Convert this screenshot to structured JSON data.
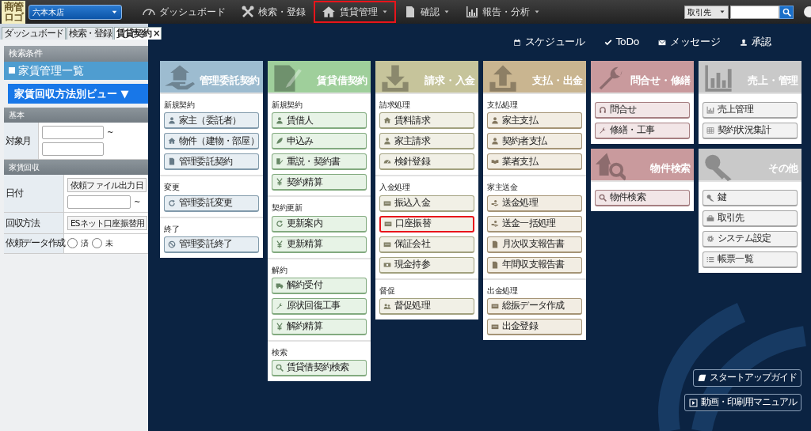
{
  "logo": {
    "text": "商管ロゴ"
  },
  "store_select": {
    "value": "六本木店"
  },
  "nav": [
    {
      "label": "ダッシュボード",
      "dropdown": false,
      "highlighted": false
    },
    {
      "label": "検索・登録",
      "dropdown": false,
      "highlighted": false
    },
    {
      "label": "賃貸管理",
      "dropdown": true,
      "highlighted": true
    },
    {
      "label": "確認",
      "dropdown": true,
      "highlighted": false
    },
    {
      "label": "報告・分析",
      "dropdown": true,
      "highlighted": false
    }
  ],
  "partner_select": {
    "value": "取引先"
  },
  "tabs": [
    {
      "label": "ダッシュボード",
      "selected": false
    },
    {
      "label": "検索・登録",
      "selected": false
    },
    {
      "label": "賃貸契約",
      "selected": true,
      "close": "×"
    }
  ],
  "search_panel": {
    "header": "検索条件",
    "title": "家賃管理一覧",
    "view_button": "家賃回収方法別ビュー ▼",
    "sections": [
      {
        "heading": "基本",
        "fields": [
          {
            "kind": "range",
            "label": "対象月",
            "separator": "~"
          }
        ]
      },
      {
        "heading": "家賃回収",
        "fields": [
          {
            "kind": "select_range",
            "label": "日付",
            "value": "依頼ファイル出力日",
            "separator": "~"
          },
          {
            "kind": "select",
            "label": "回収方法",
            "value": "ESネット口座振替用"
          },
          {
            "kind": "radio",
            "label": "依頼データ作成",
            "options": [
              {
                "label": "済",
                "selected": false
              },
              {
                "label": "未",
                "selected": false
              }
            ]
          }
        ]
      }
    ]
  },
  "top_links": [
    {
      "label": "スケジュール"
    },
    {
      "label": "ToDo"
    },
    {
      "label": "メッセージ"
    },
    {
      "label": "承認"
    }
  ],
  "columns": [
    {
      "tiles": [
        {
          "title": "管理委託契約",
          "color": "#9dbcd0",
          "sections": [
            {
              "heading": "新規契約",
              "buttons": [
                {
                  "label": "家主（委託者）",
                  "highlighted": false
                },
                {
                  "label": "物件（建物・部屋）",
                  "highlighted": false
                },
                {
                  "label": "管理委託契約",
                  "highlighted": false
                }
              ]
            },
            {
              "heading": "変更",
              "buttons": [
                {
                  "label": "管理委託変更",
                  "highlighted": false
                }
              ]
            },
            {
              "heading": "終了",
              "buttons": [
                {
                  "label": "管理委託終了",
                  "highlighted": false
                }
              ]
            }
          ]
        }
      ]
    },
    {
      "tiles": [
        {
          "title": "賃貸借契約",
          "color": "#9fcf9b",
          "sections": [
            {
              "heading": "新規契約",
              "buttons": [
                {
                  "label": "賃借人",
                  "highlighted": false
                },
                {
                  "label": "申込み",
                  "highlighted": false
                },
                {
                  "label": "重説・契約書",
                  "highlighted": false
                },
                {
                  "label": "契約精算",
                  "highlighted": false
                }
              ]
            },
            {
              "heading": "契約更新",
              "buttons": [
                {
                  "label": "更新案内",
                  "highlighted": false
                },
                {
                  "label": "更新精算",
                  "highlighted": false
                }
              ]
            },
            {
              "heading": "解約",
              "buttons": [
                {
                  "label": "解約受付",
                  "highlighted": false
                },
                {
                  "label": "原状回復工事",
                  "highlighted": false
                },
                {
                  "label": "解約精算",
                  "highlighted": false
                }
              ]
            },
            {
              "heading": "検索",
              "buttons": [
                {
                  "label": "賃貸借契約検索",
                  "highlighted": false
                }
              ]
            }
          ]
        }
      ]
    },
    {
      "tiles": [
        {
          "title": "請求・入金",
          "color": "#c6c49b",
          "sections": [
            {
              "heading": "請求処理",
              "buttons": [
                {
                  "label": "賃料請求",
                  "highlighted": false
                },
                {
                  "label": "家主請求",
                  "highlighted": false
                },
                {
                  "label": "検針登録",
                  "highlighted": false
                }
              ]
            },
            {
              "heading": "入金処理",
              "buttons": [
                {
                  "label": "振込入金",
                  "highlighted": false
                },
                {
                  "label": "口座振替",
                  "highlighted": true
                },
                {
                  "label": "保証会社",
                  "highlighted": false
                },
                {
                  "label": "現金持参",
                  "highlighted": false
                }
              ]
            },
            {
              "heading": "督促",
              "buttons": [
                {
                  "label": "督促処理",
                  "highlighted": false
                }
              ]
            }
          ]
        }
      ]
    },
    {
      "tiles": [
        {
          "title": "支払・出金",
          "color": "#c9b590",
          "sections": [
            {
              "heading": "支払処理",
              "buttons": [
                {
                  "label": "家主支払",
                  "highlighted": false
                },
                {
                  "label": "契約者支払",
                  "highlighted": false
                },
                {
                  "label": "業者支払",
                  "highlighted": false
                }
              ]
            },
            {
              "heading": "家主送金",
              "buttons": [
                {
                  "label": "送金処理",
                  "highlighted": false
                },
                {
                  "label": "送金一括処理",
                  "highlighted": false
                },
                {
                  "label": "月次収支報告書",
                  "highlighted": false
                },
                {
                  "label": "年間収支報告書",
                  "highlighted": false
                }
              ]
            },
            {
              "heading": "出金処理",
              "buttons": [
                {
                  "label": "総振データ作成",
                  "highlighted": false
                },
                {
                  "label": "出金登録",
                  "highlighted": false
                }
              ]
            }
          ]
        }
      ]
    },
    {
      "tiles": [
        {
          "title": "問合せ・修繕",
          "color": "#c99a9d",
          "sections": [
            {
              "buttons": [
                {
                  "label": "問合せ",
                  "highlighted": false
                },
                {
                  "label": "修繕・工事",
                  "highlighted": false
                }
              ]
            }
          ]
        },
        {
          "title": "物件検索",
          "color": "#c99a9d",
          "sections": [
            {
              "buttons": [
                {
                  "label": "物件検索",
                  "highlighted": false
                }
              ]
            }
          ]
        }
      ]
    },
    {
      "tiles": [
        {
          "title": "売上・管理",
          "color": "#c9c9c9",
          "sections": [
            {
              "buttons": [
                {
                  "label": "売上管理",
                  "highlighted": false
                },
                {
                  "label": "契約状況集計",
                  "highlighted": false
                }
              ]
            }
          ]
        },
        {
          "title": "その他",
          "color": "#c9c9c9",
          "sections": [
            {
              "buttons": [
                {
                  "label": "鍵",
                  "highlighted": false
                },
                {
                  "label": "取引先",
                  "highlighted": false
                },
                {
                  "label": "システム設定",
                  "highlighted": false
                },
                {
                  "label": "帳票一覧",
                  "highlighted": false
                }
              ]
            }
          ]
        }
      ]
    }
  ],
  "guide_buttons": [
    {
      "label": "スタートアップガイド"
    },
    {
      "label": "動画・印刷用マニュアル"
    }
  ]
}
